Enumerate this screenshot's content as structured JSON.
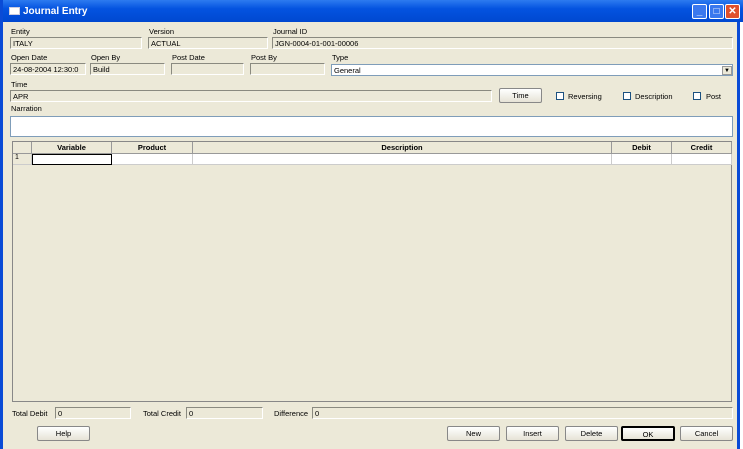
{
  "window": {
    "title": "Journal Entry"
  },
  "fields": {
    "entity": {
      "label": "Entity",
      "value": "ITALY"
    },
    "version": {
      "label": "Version",
      "value": "ACTUAL"
    },
    "journal_id": {
      "label": "Journal ID",
      "value": "JGN-0004-01-001-00006"
    },
    "open_date": {
      "label": "Open Date",
      "value": "24-08-2004  12:30:0"
    },
    "open_by": {
      "label": "Open By",
      "value": "Build"
    },
    "post_date": {
      "label": "Post Date",
      "value": ""
    },
    "post_by": {
      "label": "Post By",
      "value": ""
    },
    "type": {
      "label": "Type",
      "value": "General"
    },
    "time": {
      "label": "Time",
      "value": "APR"
    },
    "narration": {
      "label": "Narration",
      "value": ""
    }
  },
  "time_button": "Time",
  "checkboxes": {
    "reversing": "Reversing",
    "description": "Description",
    "post": "Post"
  },
  "grid": {
    "columns": [
      "Variable",
      "Product",
      "Description",
      "Debit",
      "Credit"
    ],
    "rows": [
      {
        "num": "1"
      }
    ]
  },
  "totals": {
    "total_debit": {
      "label": "Total Debit",
      "value": "0"
    },
    "total_credit": {
      "label": "Total Credit",
      "value": "0"
    },
    "difference": {
      "label": "Difference",
      "value": "0"
    }
  },
  "buttons": {
    "help": "Help",
    "new": "New",
    "insert": "Insert",
    "delete": "Delete",
    "ok": "OK",
    "cancel": "Cancel"
  }
}
